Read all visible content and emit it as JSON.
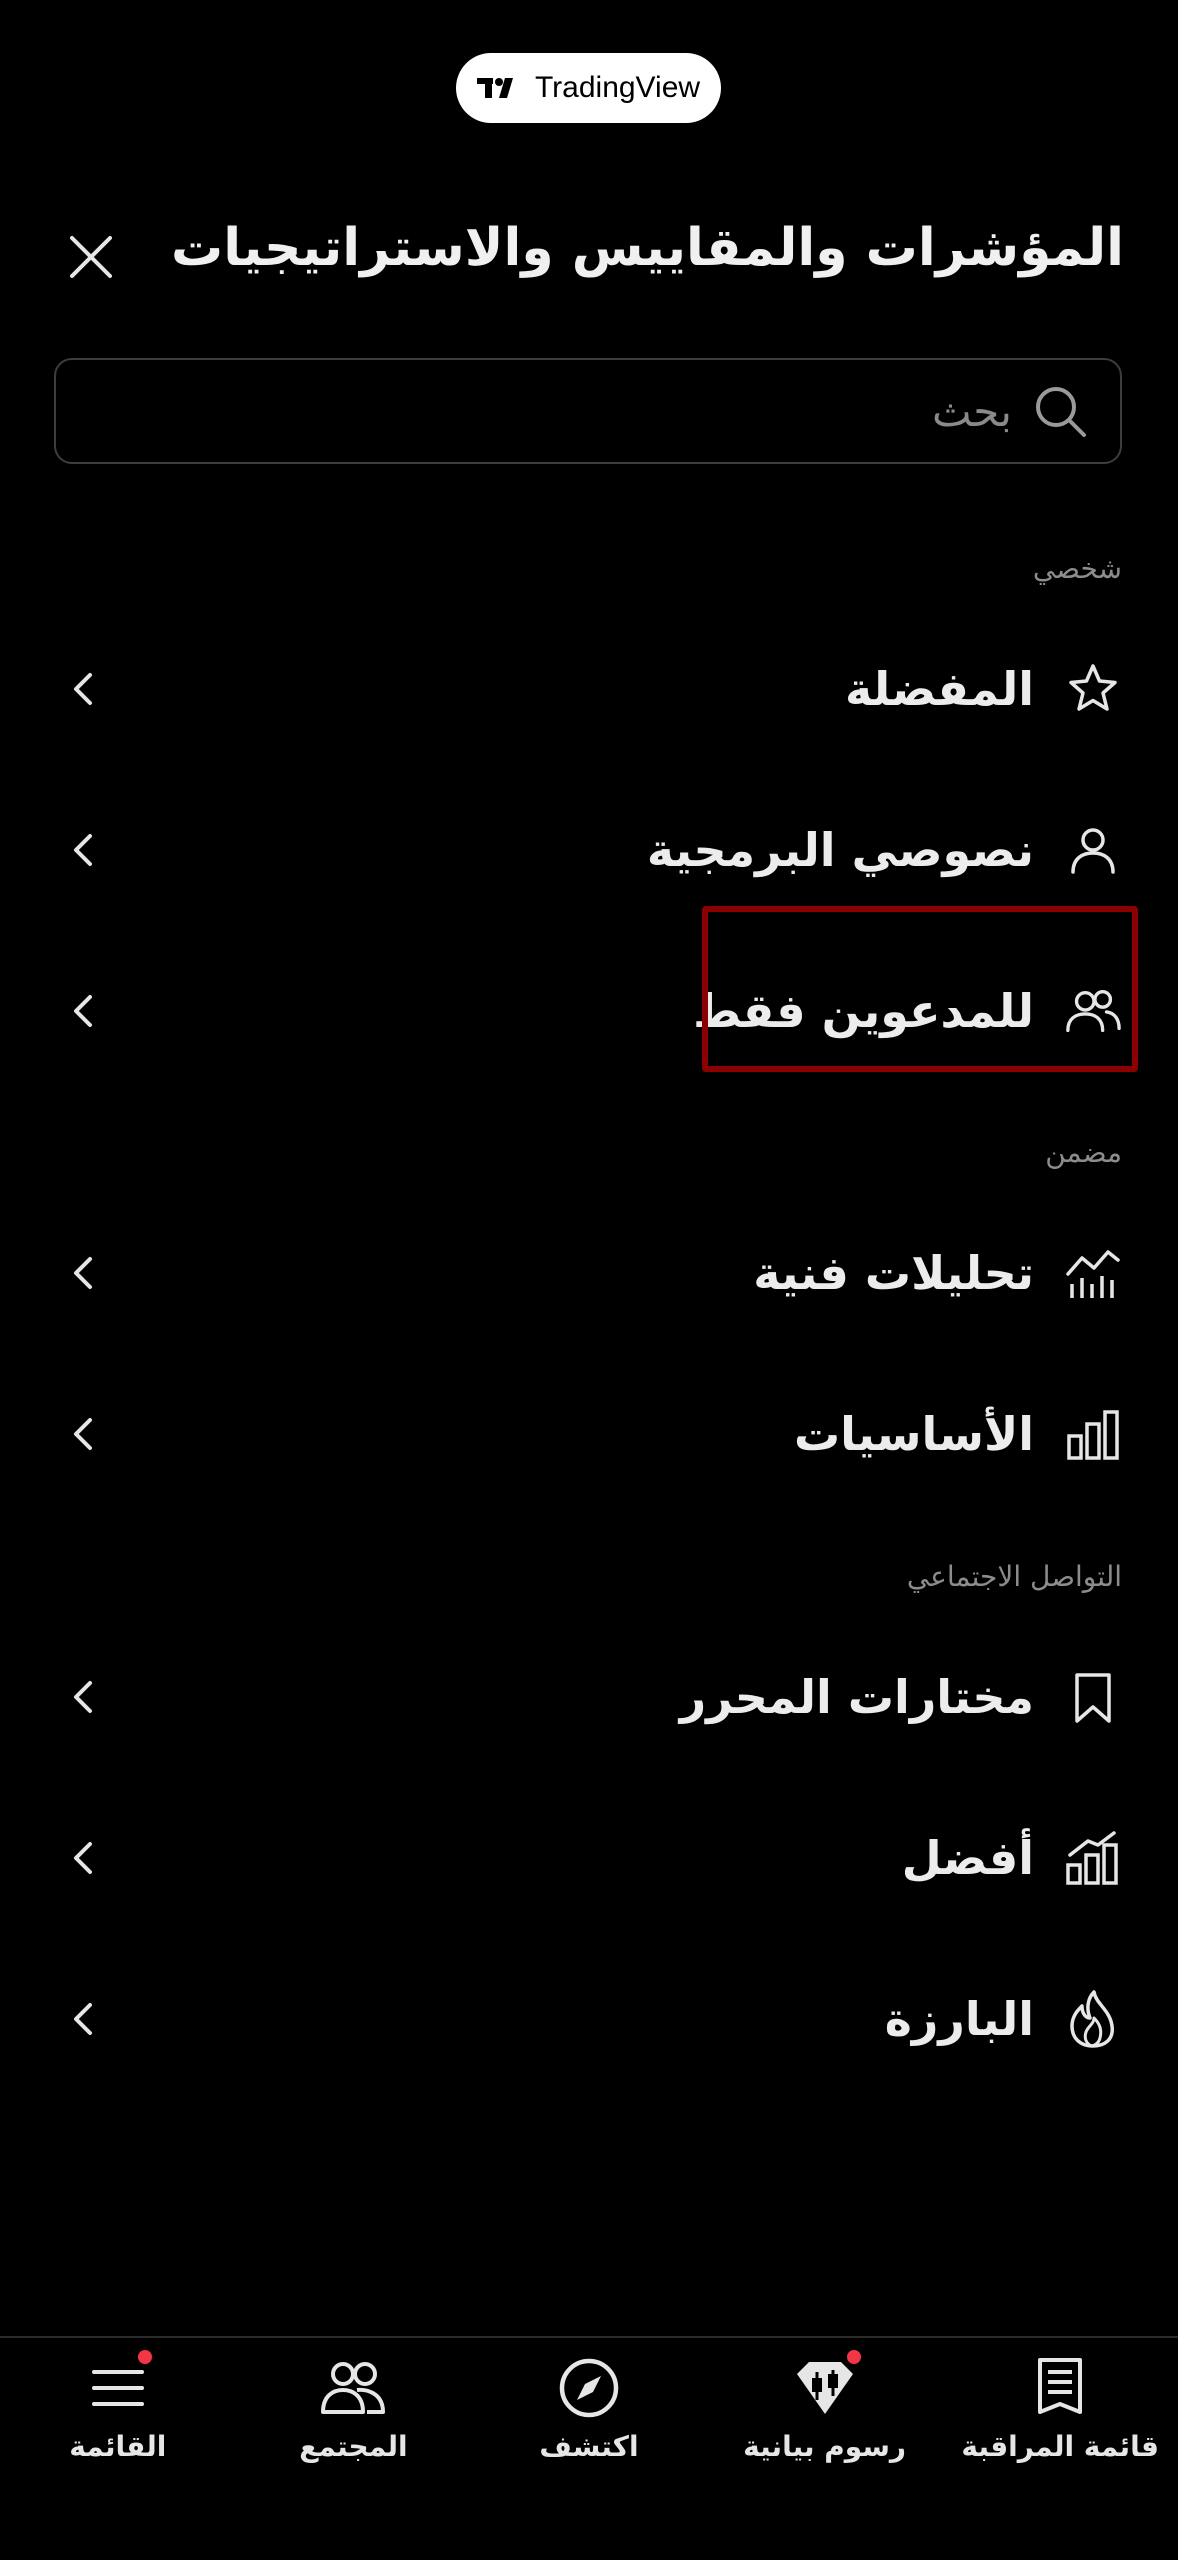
{
  "brand": {
    "name": "TradingView"
  },
  "header": {
    "title": "المؤشرات والمقاييس والاستراتيجيات"
  },
  "search": {
    "placeholder": "بحث"
  },
  "sections": {
    "personal": {
      "title": "شخصي",
      "items": [
        {
          "label": "المفضلة",
          "icon": "star-icon"
        },
        {
          "label": "نصوصي البرمجية",
          "icon": "user-icon"
        },
        {
          "label": "للمدعوين فقط",
          "icon": "users-icon",
          "highlighted": true
        }
      ]
    },
    "builtin": {
      "title": "مضمن",
      "items": [
        {
          "label": "تحليلات فنية",
          "icon": "technicals-icon"
        },
        {
          "label": "الأساسيات",
          "icon": "bar-chart-icon"
        }
      ]
    },
    "community": {
      "title": "التواصل الاجتماعي",
      "items": [
        {
          "label": "مختارات المحرر",
          "icon": "bookmark-icon"
        },
        {
          "label": "أفضل",
          "icon": "top-chart-icon"
        },
        {
          "label": "البارزة",
          "icon": "flame-icon"
        }
      ]
    }
  },
  "bottom_nav": [
    {
      "label": "قائمة المراقبة",
      "icon": "watchlist-icon"
    },
    {
      "label": "رسوم بيانية",
      "icon": "chart-icon",
      "badge": true
    },
    {
      "label": "اكتشف",
      "icon": "compass-icon"
    },
    {
      "label": "المجتمع",
      "icon": "community-icon"
    },
    {
      "label": "القائمة",
      "icon": "menu-icon",
      "badge": true
    }
  ],
  "colors": {
    "background": "#000000",
    "highlight_border": "#8b0000",
    "badge": "#f23645"
  }
}
